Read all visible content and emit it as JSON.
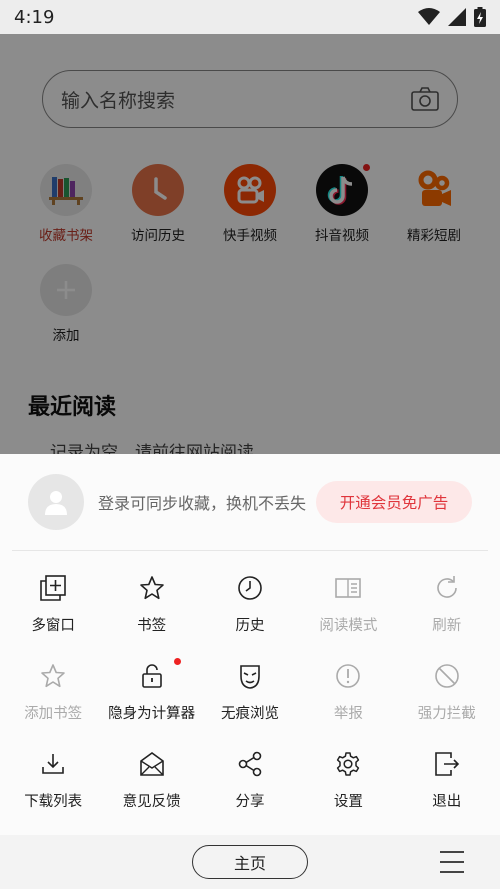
{
  "status": {
    "time": "4:19"
  },
  "search": {
    "placeholder": "输入名称搜索"
  },
  "shortcuts": [
    {
      "label": "收藏书架",
      "icon": "bookshelf-icon",
      "color": "#c0392b"
    },
    {
      "label": "访问历史",
      "icon": "clock-icon"
    },
    {
      "label": "快手视频",
      "icon": "kuaishou-icon"
    },
    {
      "label": "抖音视频",
      "icon": "douyin-icon"
    },
    {
      "label": "精彩短剧",
      "icon": "drama-icon"
    },
    {
      "label": "添加",
      "icon": "add-icon"
    }
  ],
  "recent": {
    "title": "最近阅读",
    "empty": "记录为空，请前往网站阅读"
  },
  "sheet": {
    "login_hint": "登录可同步收藏，换机不丢失",
    "vip_label": "开通会员免广告",
    "menu": [
      [
        {
          "label": "多窗口",
          "icon": "multi-window-icon",
          "enabled": true
        },
        {
          "label": "书签",
          "icon": "star-icon",
          "enabled": true
        },
        {
          "label": "历史",
          "icon": "clock-icon",
          "enabled": true
        },
        {
          "label": "阅读模式",
          "icon": "reader-mode-icon",
          "enabled": false
        },
        {
          "label": "刷新",
          "icon": "refresh-icon",
          "enabled": false
        }
      ],
      [
        {
          "label": "添加书签",
          "icon": "star-add-icon",
          "enabled": false
        },
        {
          "label": "隐身为计算器",
          "icon": "lock-icon",
          "enabled": true
        },
        {
          "label": "无痕浏览",
          "icon": "mask-icon",
          "enabled": true
        },
        {
          "label": "举报",
          "icon": "alert-icon",
          "enabled": false
        },
        {
          "label": "强力拦截",
          "icon": "block-icon",
          "enabled": false
        }
      ],
      [
        {
          "label": "下载列表",
          "icon": "download-icon",
          "enabled": true
        },
        {
          "label": "意见反馈",
          "icon": "feedback-icon",
          "enabled": true
        },
        {
          "label": "分享",
          "icon": "share-icon",
          "enabled": true
        },
        {
          "label": "设置",
          "icon": "gear-icon",
          "enabled": true
        },
        {
          "label": "退出",
          "icon": "exit-icon",
          "enabled": true
        }
      ]
    ]
  },
  "bottom": {
    "home_label": "主页"
  },
  "colors": {
    "accent": "#e0353c",
    "vip_bg": "#fde8e8"
  }
}
